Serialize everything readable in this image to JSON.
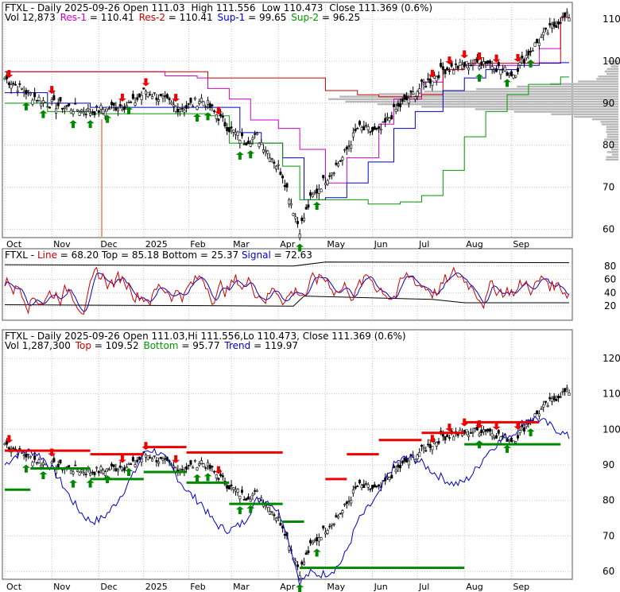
{
  "chart_data": [
    {
      "type": "candlestick",
      "title": "FTXL - Daily 2025-09-26 Open 111.03  High 111.556  Low 110.473  Close 111.369 (0.6%)",
      "title_parts": {
        "symbol": "FTXL",
        "dash": "-",
        "frequency": "Daily",
        "date": "2025-09-26",
        "open_label": "Open",
        "open": "111.03",
        "high_label": "High",
        "high": "111.556",
        "low_label": "Low",
        "low": "110.473",
        "close_label": "Close",
        "close": "111.369",
        "change": "(0.6%)"
      },
      "legend_parts": {
        "vol_label": "Vol",
        "vol": "12,873",
        "res1_label": "Res-1",
        "res1": "110.41",
        "res2_label": "Res-2",
        "res2": "110.41",
        "sup1_label": "Sup-1",
        "sup1": "99.65",
        "sup2_label": "Sup-2",
        "sup2": "96.25",
        "eq": "="
      },
      "legend_text": "Vol 12,873  Res-1 = 110.41,  Res-2 = 110.41,  Sup-1 = 99.65,  Sup-2 = 96.25",
      "months": [
        "Oct",
        "Nov",
        "Dec",
        "2025",
        "Feb",
        "Mar",
        "Apr",
        "May",
        "Jun",
        "Jul",
        "Aug",
        "Sep"
      ],
      "y_ticks": [
        "110",
        "100",
        "90",
        "80",
        "70",
        "60"
      ],
      "ylim": [
        58,
        114
      ],
      "series": [
        {
          "name": "Res-1",
          "color": "#cc00cc"
        },
        {
          "name": "Res-2",
          "color": "#cc0000"
        },
        {
          "name": "Sup-1",
          "color": "#0000cc"
        },
        {
          "name": "Sup-2",
          "color": "#009900"
        }
      ]
    },
    {
      "type": "line",
      "title_parts": {
        "symbol": "FTXL",
        "line_label": "Line",
        "line": "68.20",
        "top_label": "Top",
        "top": "85.18",
        "bottom_label": "Bottom",
        "bottom": "25.37",
        "signal_label": "Signal",
        "signal": "72.63"
      },
      "title": "FTXL - Line = 68.20,  Top = 85.18,  Bottom = 25.37,  Signal = 72.63",
      "y_ticks": [
        "80",
        "60",
        "40",
        "20"
      ],
      "ylim": [
        0,
        100
      ]
    },
    {
      "type": "candlestick",
      "title": "FTXL - Daily 2025-09-26 Open 111.03,Hi 111.556,Lo 110.473,  Close 111.369 (0.6%)",
      "legend_parts": {
        "vol": "1,287,300",
        "top": "109.52",
        "bottom": "95.77",
        "trend": "119.97"
      },
      "legend_text": "Vol 1,287,300  Top = 109.52,  Bottom = 95.77,  Trend = 119.97",
      "months": [
        "Oct",
        "Nov",
        "Dec",
        "2025",
        "Feb",
        "Mar",
        "Apr",
        "May",
        "Jun",
        "Jul",
        "Aug",
        "Sep"
      ],
      "y_ticks": [
        "120",
        "110",
        "100",
        "90",
        "80",
        "70",
        "60"
      ],
      "ylim": [
        58,
        122
      ]
    }
  ],
  "colors": {
    "up": "#008800",
    "down": "#ee0000",
    "grid": "#c0c0c0",
    "line": "#cc0000",
    "signal": "#0000cc",
    "band": "#000000"
  }
}
